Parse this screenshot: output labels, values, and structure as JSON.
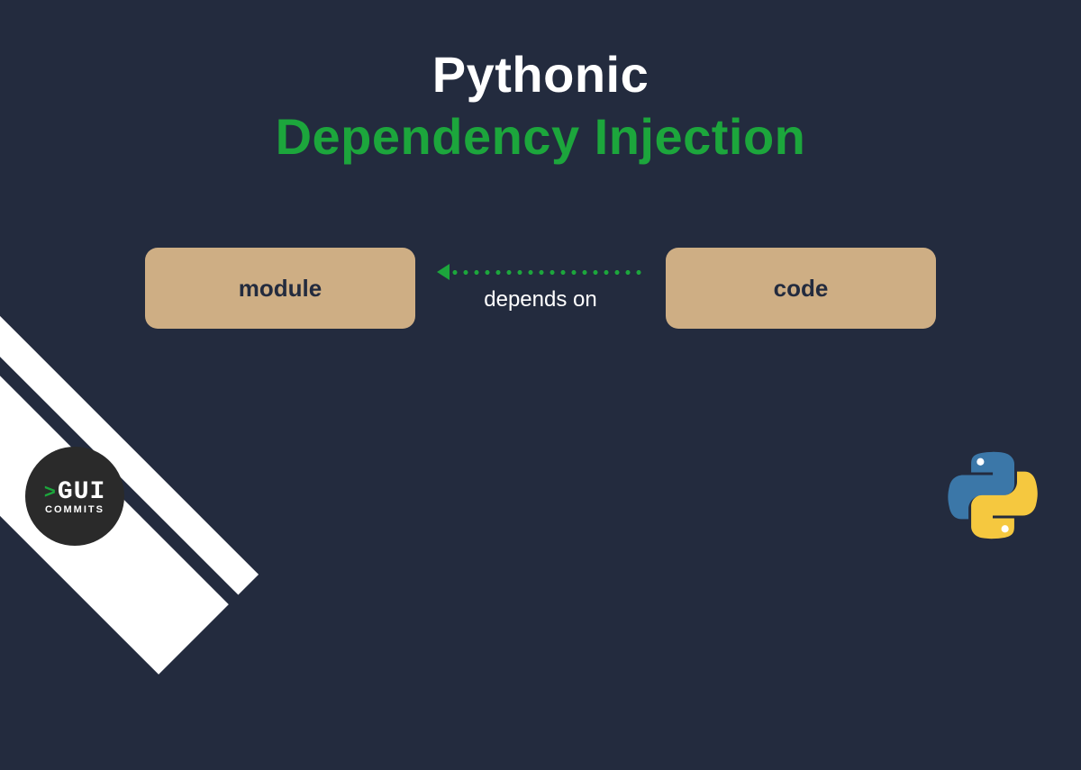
{
  "title": {
    "line1": "Pythonic",
    "line2": "Dependency Injection"
  },
  "diagram": {
    "left_box": "module",
    "right_box": "code",
    "connector_label": "depends on",
    "direction": "right-to-left"
  },
  "badge": {
    "prompt": ">",
    "main": "GUI",
    "sub": "COMMITS"
  },
  "colors": {
    "background": "#232b3e",
    "accent_green": "#1ca63c",
    "box_fill": "#ceae84",
    "text_white": "#ffffff",
    "python_blue": "#3b77a8",
    "python_yellow": "#f5c83f"
  }
}
